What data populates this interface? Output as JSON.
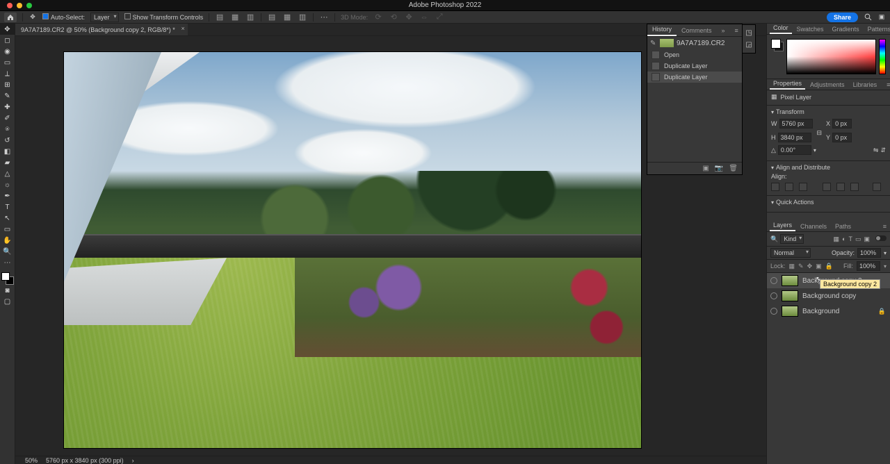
{
  "app_title": "Adobe Photoshop 2022",
  "options": {
    "auto_select": "Auto-Select:",
    "auto_select_mode": "Layer",
    "show_transform": "Show Transform Controls",
    "mode_3d": "3D Mode:"
  },
  "share": "Share",
  "doc_tab": "9A7A7189.CR2 @ 50% (Background copy 2, RGB/8*) *",
  "history": {
    "tabs": [
      "History",
      "Comments"
    ],
    "doc": "9A7A7189.CR2",
    "items": [
      "Open",
      "Duplicate Layer",
      "Duplicate Layer"
    ]
  },
  "color": {
    "tabs": [
      "Color",
      "Swatches",
      "Gradients",
      "Patterns"
    ]
  },
  "properties": {
    "tabs": [
      "Properties",
      "Adjustments",
      "Libraries"
    ],
    "kind": "Pixel Layer",
    "transform": {
      "title": "Transform",
      "w": "5760 px",
      "x": "0 px",
      "h": "3840 px",
      "y": "0 px",
      "angle": "0.00°"
    },
    "align": {
      "title": "Align and Distribute",
      "label": "Align:"
    },
    "quick": "Quick Actions"
  },
  "layers": {
    "tabs": [
      "Layers",
      "Channels",
      "Paths"
    ],
    "filter_label": "Kind",
    "blend": "Normal",
    "opacity_label": "Opacity:",
    "opacity": "100%",
    "lock_label": "Lock:",
    "fill_label": "Fill:",
    "fill": "100%",
    "items": [
      {
        "name": "Background copy 2",
        "sel": true,
        "tooltip": "Background copy 2"
      },
      {
        "name": "Background copy"
      },
      {
        "name": "Background",
        "locked": true
      }
    ]
  },
  "status": {
    "zoom": "50%",
    "dims": "5760 px x 3840 px (300 ppi)"
  }
}
